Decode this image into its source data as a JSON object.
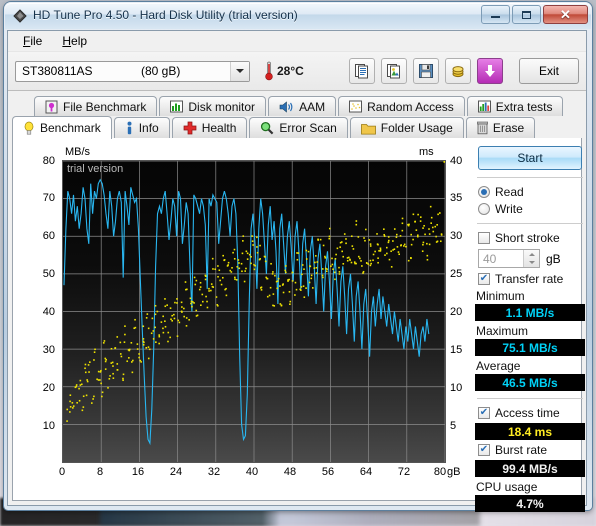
{
  "window": {
    "title": "HD Tune Pro 4.50 - Hard Disk Utility (trial version)",
    "app_icon": "hdtune-diamond-icon",
    "buttons": {
      "minimize": "minimize-icon",
      "maximize": "maximize-icon",
      "close": "close-icon",
      "close_glyph": "✕"
    }
  },
  "menu": {
    "items": [
      {
        "label": "File",
        "accel": "F"
      },
      {
        "label": "Help",
        "accel": "H"
      }
    ]
  },
  "toolbar": {
    "drive": {
      "name": "ST380811AS",
      "capacity": "(80 gB)"
    },
    "temperature": "28°C",
    "temp_icon": "thermometer-icon",
    "icons": [
      {
        "name": "copy-text-icon"
      },
      {
        "name": "copy-image-icon"
      },
      {
        "name": "save-icon"
      },
      {
        "name": "license-icon"
      },
      {
        "name": "download-icon"
      }
    ],
    "exit_label": "Exit"
  },
  "tabs": {
    "row1": [
      {
        "label": "File Benchmark",
        "icon": "file-benchmark-icon",
        "active": false
      },
      {
        "label": "Disk monitor",
        "icon": "disk-monitor-icon",
        "active": false
      },
      {
        "label": "AAM",
        "icon": "speaker-icon",
        "active": false
      },
      {
        "label": "Random Access",
        "icon": "random-access-icon",
        "active": false
      },
      {
        "label": "Extra tests",
        "icon": "extra-tests-icon",
        "active": false
      }
    ],
    "row2": [
      {
        "label": "Benchmark",
        "icon": "lightbulb-icon",
        "active": true
      },
      {
        "label": "Info",
        "icon": "info-icon",
        "active": false
      },
      {
        "label": "Health",
        "icon": "health-cross-icon",
        "active": false
      },
      {
        "label": "Error Scan",
        "icon": "magnifier-icon",
        "active": false
      },
      {
        "label": "Folder Usage",
        "icon": "folder-icon",
        "active": false
      },
      {
        "label": "Erase",
        "icon": "trash-icon",
        "active": false
      }
    ]
  },
  "controls": {
    "start_label": "Start",
    "mode": {
      "read_label": "Read",
      "write_label": "Write",
      "selected": "Read"
    },
    "short_stroke": {
      "label": "Short stroke",
      "checked": false,
      "value": "40",
      "unit": "gB"
    },
    "transfer_rate": {
      "label": "Transfer rate",
      "checked": true
    },
    "access_time": {
      "label": "Access time",
      "checked": true
    },
    "burst_rate": {
      "label": "Burst rate",
      "checked": true
    }
  },
  "results": {
    "minimum": {
      "label": "Minimum",
      "value": "1.1 MB/s",
      "color": "#00d2f7"
    },
    "maximum": {
      "label": "Maximum",
      "value": "75.1 MB/s",
      "color": "#00d2f7"
    },
    "average": {
      "label": "Average",
      "value": "46.5 MB/s",
      "color": "#00d2f7"
    },
    "access_time": {
      "value": "18.4 ms",
      "color": "#ffec23"
    },
    "burst_rate": {
      "value": "99.4 MB/s",
      "color": "#f2f2f2"
    },
    "cpu_usage": {
      "label": "CPU usage",
      "value": "4.7%",
      "color": "#f2f2f2"
    }
  },
  "chart_data": {
    "type": "line",
    "title": "",
    "watermark": "trial version",
    "xlabel": "gB",
    "ylabel": "MB/s",
    "y2label": "ms",
    "xlim": [
      0,
      80
    ],
    "ylim": [
      0,
      80
    ],
    "y2lim": [
      0,
      40
    ],
    "xticks": [
      0,
      8,
      16,
      24,
      32,
      40,
      48,
      56,
      64,
      72,
      80
    ],
    "yticks": [
      10,
      20,
      30,
      40,
      50,
      60,
      70,
      80
    ],
    "y2ticks": [
      5,
      10,
      15,
      20,
      25,
      30,
      35,
      40
    ],
    "grid": true,
    "legend": "none",
    "series": [
      {
        "name": "Transfer rate",
        "type": "line",
        "color": "#29b6f0",
        "axis": "left",
        "x": [
          0.2,
          0.6,
          1.0,
          1.4,
          1.8,
          2.2,
          2.6,
          3.0,
          3.4,
          3.8,
          4.2,
          4.6,
          5.0,
          5.4,
          5.8,
          6.2,
          6.6,
          7.0,
          7.4,
          7.8,
          8.2,
          8.6,
          9.0,
          9.4,
          9.8,
          10.2,
          10.6,
          11.0,
          11.4,
          11.8,
          12.2,
          12.6,
          13.0,
          13.4,
          13.8,
          14.2,
          14.6,
          15.0,
          15.4,
          15.8,
          16.2,
          16.6,
          17.0,
          17.4,
          17.8,
          18.2,
          18.6,
          19.0,
          19.4,
          19.8,
          20.2,
          20.6,
          21.0,
          21.4,
          21.8,
          22.2,
          22.6,
          23.0,
          23.4,
          23.8,
          24.2,
          24.6,
          25.0,
          25.4,
          25.8,
          26.2,
          26.6,
          27.0,
          27.4,
          27.8,
          28.2,
          28.6,
          29.0,
          29.4,
          29.8,
          30.2,
          30.6,
          31.0,
          31.4,
          31.8,
          32.2,
          32.6,
          33.0,
          33.4,
          33.8,
          34.2,
          34.6,
          35.0,
          35.4,
          35.8,
          36.2,
          36.6,
          37.0,
          37.4,
          37.8,
          38.2,
          38.6,
          39.0,
          39.4,
          39.8,
          40.2,
          40.6,
          41.0,
          41.4,
          41.8,
          42.2,
          42.6,
          43.0,
          43.4,
          43.8,
          44.2,
          44.6,
          45.0,
          45.4,
          45.8,
          46.2,
          46.6,
          47.0,
          47.4,
          47.8,
          48.2,
          48.6,
          49.0,
          49.4,
          49.8,
          50.2,
          50.6,
          51.0,
          51.4,
          51.8,
          52.2,
          52.6,
          53.0,
          53.4,
          53.8,
          54.2,
          54.6,
          55.0,
          55.4,
          55.8,
          56.2,
          56.6,
          57.0,
          57.4,
          57.8,
          58.2,
          58.6,
          59.0,
          59.4,
          59.8,
          60.2,
          60.6,
          61.0,
          61.4,
          61.8,
          62.2,
          62.6,
          63.0,
          63.4,
          63.8,
          64.2,
          64.6,
          65.0,
          65.4,
          65.8,
          66.2,
          66.6,
          67.0,
          67.4,
          67.8,
          68.2,
          68.6,
          69.0,
          69.4,
          69.8,
          70.2,
          70.6,
          71.0,
          71.4,
          71.8,
          72.2,
          72.6,
          73.0,
          73.4,
          73.8,
          74.2,
          74.6,
          75.0,
          75.4,
          75.8,
          76.2,
          76.6,
          77.0,
          77.4,
          77.8,
          78.2,
          78.6,
          79.0,
          79.4,
          79.8
        ],
        "y": [
          47,
          62,
          72,
          70,
          66,
          71,
          64,
          68,
          62,
          66,
          73,
          70,
          62,
          58,
          74,
          66,
          72,
          70,
          74,
          75,
          74,
          71,
          66,
          62,
          72,
          68,
          60,
          64,
          70,
          72,
          69,
          49,
          72,
          68,
          63,
          73,
          71,
          69,
          70,
          62,
          48,
          35,
          23,
          12,
          6,
          5,
          14,
          30,
          52,
          66,
          68,
          66,
          70,
          72,
          66,
          59,
          64,
          70,
          68,
          60,
          72,
          70,
          58,
          63,
          69,
          66,
          52,
          40,
          71,
          70,
          68,
          66,
          70,
          68,
          63,
          46,
          70,
          68,
          71,
          70,
          69,
          58,
          64,
          70,
          72,
          70,
          66,
          60,
          68,
          70,
          66,
          53,
          28,
          10,
          6,
          7,
          18,
          42,
          62,
          66,
          58,
          46,
          62,
          70,
          66,
          58,
          50,
          63,
          68,
          59,
          64,
          56,
          42,
          62,
          66,
          58,
          50,
          60,
          64,
          57,
          48,
          60,
          64,
          56,
          46,
          58,
          62,
          54,
          44,
          56,
          60,
          52,
          42,
          54,
          58,
          50,
          40,
          52,
          56,
          48,
          38,
          50,
          54,
          46,
          36,
          48,
          52,
          44,
          34,
          46,
          50,
          42,
          32,
          44,
          48,
          40,
          30,
          42,
          46,
          38,
          28,
          40,
          44,
          36,
          42,
          46,
          38,
          44,
          40,
          36,
          42,
          38,
          34,
          40,
          36,
          32,
          38,
          34,
          30,
          36,
          32,
          38,
          34,
          30,
          36,
          32,
          28,
          34,
          36,
          32,
          38,
          34
        ]
      },
      {
        "name": "Access time",
        "type": "scatter",
        "color": "#f0e400",
        "axis": "right",
        "x": [
          1,
          1.4,
          2,
          2.4,
          3,
          3.5,
          4,
          4.5,
          5,
          5.5,
          6,
          6.5,
          7,
          7.5,
          8,
          8.5,
          9,
          9.5,
          10,
          10.5,
          11,
          11.5,
          12,
          12.5,
          13,
          13.5,
          14,
          14.5,
          15,
          15.5,
          16,
          16.5,
          17,
          17.5,
          18,
          18.5,
          19,
          19.5,
          20,
          20.5,
          21,
          21.5,
          22,
          22.5,
          23,
          23.5,
          24,
          24.5,
          25,
          25.5,
          26,
          26.5,
          27,
          27.5,
          28,
          28.5,
          29,
          29.5,
          30,
          30.5,
          31,
          31.5,
          32,
          32.5,
          33,
          33.5,
          34,
          34.5,
          35,
          35.5,
          36,
          36.5,
          37,
          37.5,
          38,
          38.5,
          39,
          39.5,
          40,
          40.5,
          41,
          41.5,
          42,
          42.5,
          43,
          43.5,
          44,
          44.5,
          45,
          45.5,
          46,
          46.5,
          47,
          47.5,
          48,
          48.5,
          49,
          49.5,
          50,
          50.5,
          51,
          51.5,
          52,
          52.5,
          53,
          53.5,
          54,
          54.5,
          55,
          55.5,
          56,
          56.5,
          57,
          57.5,
          58,
          58.5,
          59,
          59.5,
          60,
          60.5,
          61,
          61.5,
          62,
          62.5,
          63,
          63.5,
          64,
          64.5,
          65,
          65.5,
          66,
          66.5,
          67,
          67.5,
          68,
          68.5,
          69,
          69.5,
          70,
          70.5,
          71,
          71.5,
          72,
          72.5,
          73,
          73.5,
          74,
          74.5,
          75,
          75.5,
          76,
          76.5,
          77,
          77.5,
          78,
          78.5,
          79,
          79.5
        ],
        "y": [
          6,
          8,
          7,
          10,
          9,
          11,
          8,
          12,
          10,
          13,
          9,
          14,
          11,
          12,
          10,
          15,
          13,
          11,
          14,
          12,
          16,
          13,
          15,
          12,
          17,
          14,
          16,
          13,
          18,
          15,
          14,
          17,
          16,
          19,
          15,
          18,
          17,
          20,
          16,
          19,
          18,
          21,
          17,
          20,
          19,
          22,
          18,
          21,
          20,
          23,
          19,
          22,
          21,
          24,
          20,
          23,
          22,
          25,
          21,
          24,
          23,
          26,
          22,
          25,
          24,
          27,
          23,
          26,
          25,
          28,
          24,
          27,
          26,
          29,
          25,
          28,
          27,
          30,
          26,
          29,
          28,
          24,
          27,
          25,
          23,
          26,
          22,
          25,
          24,
          21,
          23,
          26,
          24,
          22,
          25,
          23,
          27,
          24,
          26,
          23,
          28,
          25,
          24,
          27,
          26,
          29,
          25,
          28,
          26,
          30,
          27,
          25,
          28,
          26,
          29,
          27,
          30,
          28,
          26,
          29,
          27,
          31,
          28,
          26,
          30,
          27,
          29,
          26,
          28,
          30,
          27,
          29,
          31,
          28,
          30,
          27,
          29,
          31,
          28,
          30,
          32,
          29,
          31,
          28,
          30,
          33,
          30,
          32,
          29,
          31,
          28,
          30,
          33,
          31,
          29,
          32,
          30
        ]
      }
    ]
  }
}
